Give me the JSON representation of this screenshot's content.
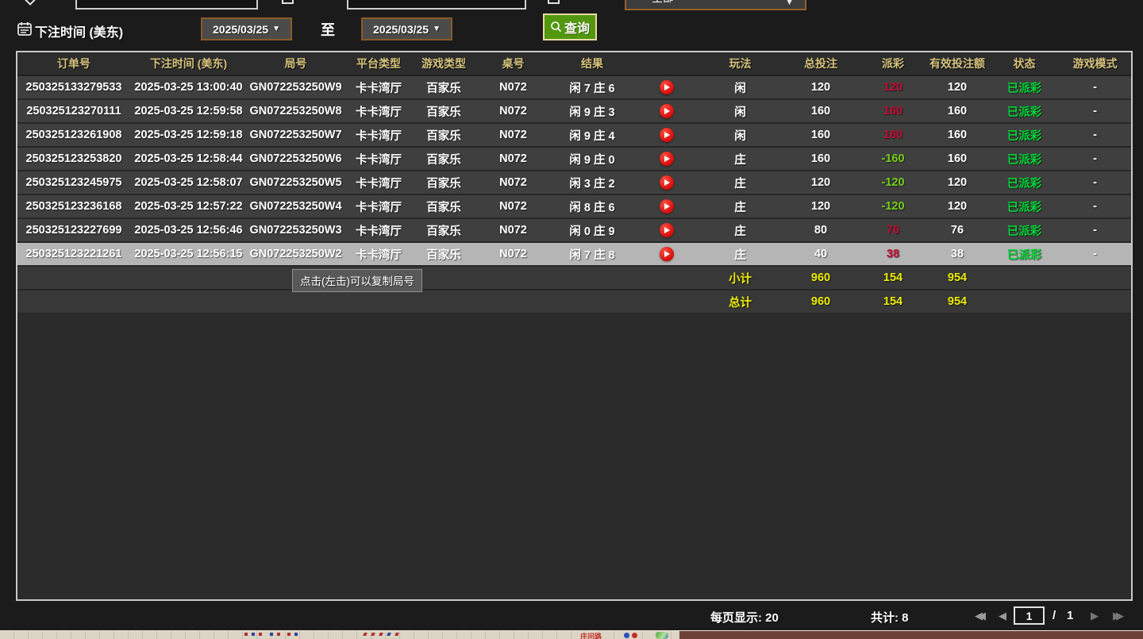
{
  "filters": {
    "bet_time_label": "下注时间 (美东)",
    "date_from": "2025/03/25",
    "date_to": "2025/03/25",
    "to_label": "至",
    "dropdown_value": "全部",
    "query_label": "查询",
    "caret": "▼"
  },
  "table": {
    "headers": [
      "订单号",
      "下注时间 (美东)",
      "局号",
      "平台类型",
      "游戏类型",
      "桌号",
      "结果",
      "",
      "玩法",
      "总投注",
      "派彩",
      "有效投注额",
      "状态",
      "游戏模式"
    ],
    "rows": [
      {
        "order": "250325133279533",
        "time": "2025-03-25 13:00:40",
        "round": "GN072253250W9",
        "platform": "卡卡湾厅",
        "game": "百家乐",
        "table_no": "N072",
        "result": "闲 7 庄 6",
        "play": "闲",
        "total": "120",
        "payout": "120",
        "valid": "120",
        "status": "已派彩",
        "mode": "-",
        "highlighted": false
      },
      {
        "order": "250325123270111",
        "time": "2025-03-25 12:59:58",
        "round": "GN072253250W8",
        "platform": "卡卡湾厅",
        "game": "百家乐",
        "table_no": "N072",
        "result": "闲 9 庄 3",
        "play": "闲",
        "total": "160",
        "payout": "160",
        "valid": "160",
        "status": "已派彩",
        "mode": "-",
        "highlighted": false
      },
      {
        "order": "250325123261908",
        "time": "2025-03-25 12:59:18",
        "round": "GN072253250W7",
        "platform": "卡卡湾厅",
        "game": "百家乐",
        "table_no": "N072",
        "result": "闲 9 庄 4",
        "play": "闲",
        "total": "160",
        "payout": "160",
        "valid": "160",
        "status": "已派彩",
        "mode": "-",
        "highlighted": false
      },
      {
        "order": "250325123253820",
        "time": "2025-03-25 12:58:44",
        "round": "GN072253250W6",
        "platform": "卡卡湾厅",
        "game": "百家乐",
        "table_no": "N072",
        "result": "闲 9 庄 0",
        "play": "庄",
        "total": "160",
        "payout": "-160",
        "valid": "160",
        "status": "已派彩",
        "mode": "-",
        "highlighted": false
      },
      {
        "order": "250325123245975",
        "time": "2025-03-25 12:58:07",
        "round": "GN072253250W5",
        "platform": "卡卡湾厅",
        "game": "百家乐",
        "table_no": "N072",
        "result": "闲 3 庄 2",
        "play": "庄",
        "total": "120",
        "payout": "-120",
        "valid": "120",
        "status": "已派彩",
        "mode": "-",
        "highlighted": false
      },
      {
        "order": "250325123236168",
        "time": "2025-03-25 12:57:22",
        "round": "GN072253250W4",
        "platform": "卡卡湾厅",
        "game": "百家乐",
        "table_no": "N072",
        "result": "闲 8 庄 6",
        "play": "庄",
        "total": "120",
        "payout": "-120",
        "valid": "120",
        "status": "已派彩",
        "mode": "-",
        "highlighted": false
      },
      {
        "order": "250325123227699",
        "time": "2025-03-25 12:56:46",
        "round": "GN072253250W3",
        "platform": "卡卡湾厅",
        "game": "百家乐",
        "table_no": "N072",
        "result": "闲 0 庄 9",
        "play": "庄",
        "total": "80",
        "payout": "76",
        "valid": "76",
        "status": "已派彩",
        "mode": "-",
        "highlighted": false
      },
      {
        "order": "250325123221261",
        "time": "2025-03-25 12:56:15",
        "round": "GN072253250W2",
        "platform": "卡卡湾厅",
        "game": "百家乐",
        "table_no": "N072",
        "result": "闲 7 庄 8",
        "play": "庄",
        "total": "40",
        "payout": "38",
        "valid": "38",
        "status": "已派彩",
        "mode": "-",
        "highlighted": true
      }
    ],
    "subtotal": {
      "label": "小计",
      "total": "960",
      "payout": "154",
      "valid": "954"
    },
    "grand_total": {
      "label": "总计",
      "total": "960",
      "payout": "154",
      "valid": "954"
    },
    "tooltip": "点击(左击)可以复制局号"
  },
  "pagination": {
    "per_page": "每页显示: 20",
    "total_count": "共计: 8",
    "current_page": "1",
    "separator": "/",
    "total_pages": "1",
    "first": "◀◀",
    "prev": "◀",
    "next": "▶",
    "last": "▶▶"
  },
  "background_window": {
    "road_label": "庄问路"
  },
  "colors": {
    "win_red": "#c50d33",
    "loss_green": "#74cf17",
    "status_green": "#00d435",
    "summary_yellow": "#ecec00",
    "header_tan": "#d6c37c",
    "accent_green": "#53970e"
  }
}
